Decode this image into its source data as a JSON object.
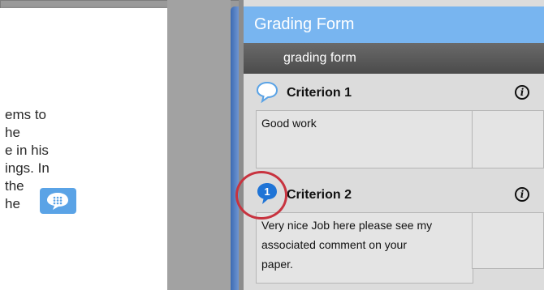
{
  "document": {
    "text_lines": [
      "ems to",
      "he",
      "e in his",
      "ings. In",
      "the",
      "he"
    ]
  },
  "panel": {
    "title": "Grading Form",
    "form_name": "grading form",
    "criteria": [
      {
        "title": "Criterion 1",
        "comment": "Good work",
        "info": "i"
      },
      {
        "title": "Criterion 2",
        "badge": "1",
        "comment": "Very nice Job here please see my associated comment on your paper.",
        "comment_lines": [
          "Very nice Job here please see my",
          "associated comment on your",
          "paper."
        ],
        "info": "i"
      }
    ]
  },
  "colors": {
    "header_blue": "#78b5f0",
    "marker_blue": "#5aa3e6",
    "highlight_red": "#c8333f"
  }
}
